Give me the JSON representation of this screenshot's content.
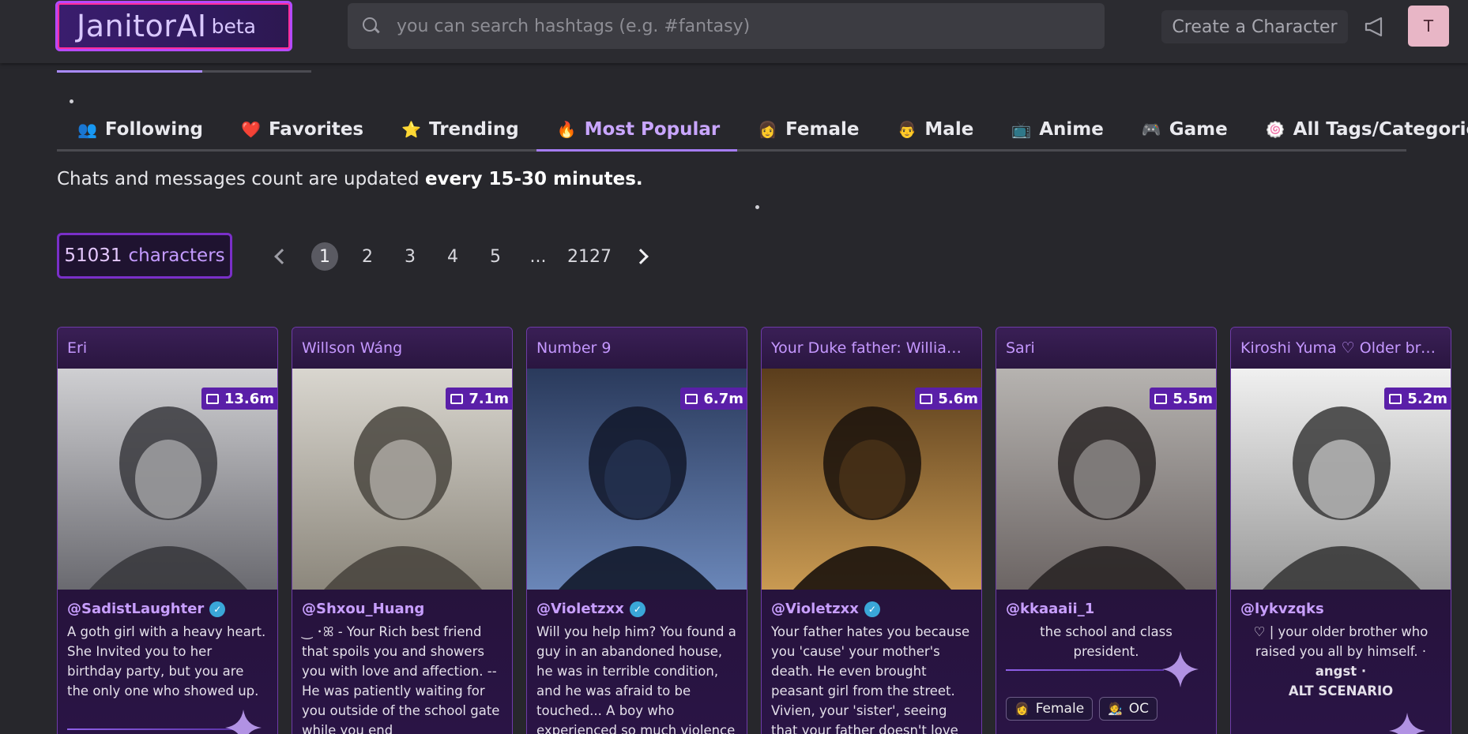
{
  "header": {
    "logo_text": "JanitorAI",
    "logo_badge": "beta",
    "search_placeholder": "you can search hashtags (e.g. #fantasy)",
    "create_label": "Create a Character",
    "avatar_initial": "T"
  },
  "load_progress": 0.57,
  "tabs": [
    {
      "emoji": "👥",
      "label": "Following"
    },
    {
      "emoji": "❤️",
      "label": "Favorites"
    },
    {
      "emoji": "⭐",
      "label": "Trending"
    },
    {
      "emoji": "🔥",
      "label": "Most Popular",
      "active": true
    },
    {
      "emoji": "👩",
      "label": "Female"
    },
    {
      "emoji": "👨",
      "label": "Male"
    },
    {
      "emoji": "📺",
      "label": "Anime"
    },
    {
      "emoji": "🎮",
      "label": "Game"
    },
    {
      "emoji": "🍥",
      "label": "All Tags/Categories"
    }
  ],
  "notice": {
    "text": "Chats and messages count are updated ",
    "emphasis": "every 15-30 minutes."
  },
  "characters_count": {
    "number": "51031",
    "label": "characters"
  },
  "pagination": {
    "pages": [
      "1",
      "2",
      "3",
      "4",
      "5"
    ],
    "current": "1",
    "ellipsis": "...",
    "last": "2127"
  },
  "cards": [
    {
      "title": "Eri",
      "chats": "13.6m",
      "creator": "@SadistLaughter",
      "verified": true,
      "description": "A goth girl with a heavy heart. She Invited you to her birthday party, but you are the only one who showed up."
    },
    {
      "title": "Willson Wáng",
      "chats": "7.1m",
      "creator": "@Shxou_Huang",
      "verified": false,
      "description": "‿ ･ꕤ - Your Rich best friend that spoils you and showers you with love and affection. -- He was patiently waiting for you outside of the school gate while you end"
    },
    {
      "title": "Number 9",
      "chats": "6.7m",
      "creator": "@Violetzxx",
      "verified": true,
      "description": "Will you help him? You found a guy in an abandoned house, he was in terrible condition, and he was afraid to be touched... A boy who experienced so much violence that he"
    },
    {
      "title": "Your Duke father: William V...",
      "chats": "5.6m",
      "creator": "@Violetzxx",
      "verified": true,
      "description": "Your father hates you because you 'cause' your mother's death. He even brought peasant girl from the street. Vivien, your 'sister', seeing that your father doesn't love"
    },
    {
      "title": "Sari",
      "chats": "5.5m",
      "creator": "@kkaaaii_1",
      "verified": false,
      "description": "the school and class president.",
      "tags": [
        {
          "emoji": "👩",
          "label": "Female"
        },
        {
          "emoji": "🧑‍🎨",
          "label": "OC"
        }
      ]
    },
    {
      "title": "Kiroshi Yuma ♡ Older broth...",
      "chats": "5.2m",
      "creator": "@lykvzqks",
      "verified": false,
      "description": "♡ | your older brother who raised you all by himself. ·",
      "description_bold": "angst ·",
      "description_bold2": "ALT SCENARIO"
    }
  ]
}
